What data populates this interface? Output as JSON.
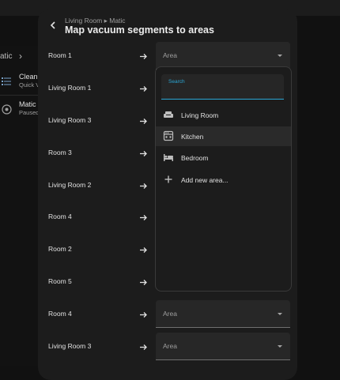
{
  "background": {
    "breadcrumb_fragment": "atic",
    "items": [
      {
        "title": "Clean r",
        "subtitle": "Quick V",
        "icon": "list-icon"
      },
      {
        "title": "Matic",
        "subtitle": "Paused",
        "icon": "robot-vacuum-icon"
      }
    ]
  },
  "dialog": {
    "subtitle": "Living Room ▸ Matic",
    "title": "Map vacuum segments to areas",
    "select_placeholder": "Area",
    "rows": [
      {
        "label": "Room 1",
        "has_select": true
      },
      {
        "label": "Living Room 1",
        "has_select": false
      },
      {
        "label": "Living Room 3",
        "has_select": false
      },
      {
        "label": "Room 3",
        "has_select": false
      },
      {
        "label": "Living Room 2",
        "has_select": false
      },
      {
        "label": "Room 4",
        "has_select": false
      },
      {
        "label": "Room 2",
        "has_select": false
      },
      {
        "label": "Room 5",
        "has_select": false
      },
      {
        "label": "Room 4",
        "has_select": true
      },
      {
        "label": "Living Room 3",
        "has_select": true
      }
    ]
  },
  "dropdown": {
    "search_label": "Search",
    "search_value": "",
    "options": [
      {
        "label": "Living Room",
        "icon": "sofa-icon",
        "highlighted": false
      },
      {
        "label": "Kitchen",
        "icon": "stove-icon",
        "highlighted": true
      },
      {
        "label": "Bedroom",
        "icon": "bed-icon",
        "highlighted": false
      },
      {
        "label": "Add new area...",
        "icon": "plus-icon",
        "highlighted": false
      }
    ]
  },
  "colors": {
    "accent": "#2aa7d6",
    "dialog_bg": "#1c1c1c",
    "page_bg": "#111111"
  }
}
